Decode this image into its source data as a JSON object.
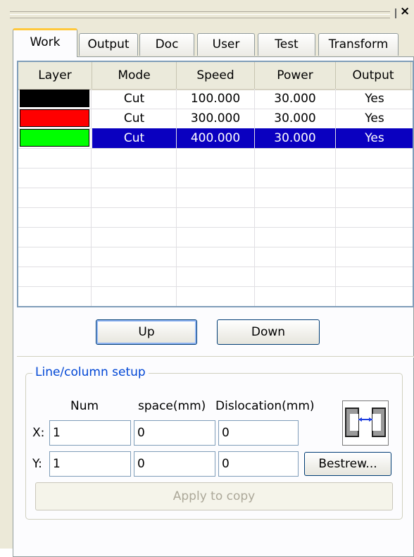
{
  "close_glyph": "×",
  "tabs": [
    "Work",
    "Output",
    "Doc",
    "User",
    "Test",
    "Transform"
  ],
  "layers": {
    "columns": [
      "Layer",
      "Mode",
      "Speed",
      "Power",
      "Output"
    ],
    "rows": [
      {
        "color": "#000000",
        "mode": "Cut",
        "speed": "100.000",
        "power": "30.000",
        "output": "Yes",
        "selected": false
      },
      {
        "color": "#ff0000",
        "mode": "Cut",
        "speed": "300.000",
        "power": "30.000",
        "output": "Yes",
        "selected": false
      },
      {
        "color": "#00ff00",
        "mode": "Cut",
        "speed": "400.000",
        "power": "30.000",
        "output": "Yes",
        "selected": true
      }
    ]
  },
  "buttons": {
    "up": "Up",
    "down": "Down",
    "bestrew": "Bestrew...",
    "apply": "Apply to copy"
  },
  "setup": {
    "legend": "Line/column setup",
    "col_num": "Num",
    "col_space": "space(mm)",
    "col_disloc": "Dislocation(mm)",
    "x_label": "X:",
    "y_label": "Y:",
    "x": {
      "num": "1",
      "space": "0",
      "disloc": "0"
    },
    "y": {
      "num": "1",
      "space": "0",
      "disloc": "0"
    }
  },
  "colors": {
    "selection": "#0a00c0",
    "accent_tab": "#ffc83c",
    "legend_text": "#0046d5"
  }
}
